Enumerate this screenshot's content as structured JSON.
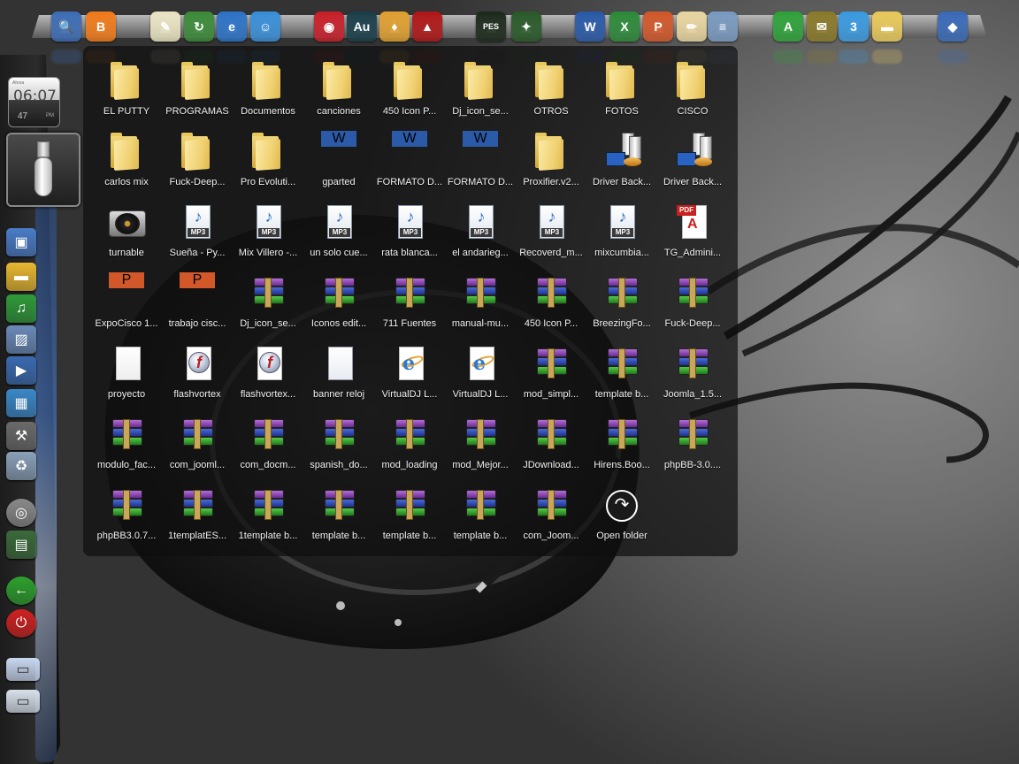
{
  "window": {
    "title": ""
  },
  "clock": {
    "time": "06:07",
    "date": "47",
    "ampm": "PM",
    "label": "Ahora"
  },
  "top_dock": {
    "icons": [
      {
        "name": "search-icon",
        "glyph": "🔍",
        "bg": "#3d6db5"
      },
      {
        "name": "blogger-icon",
        "glyph": "B",
        "bg": "#f07b1c"
      },
      {
        "name": "notepad-icon",
        "glyph": "✎",
        "bg": "#e9e4c2"
      },
      {
        "name": "sync-icon",
        "glyph": "↻",
        "bg": "#3c8b3a"
      },
      {
        "name": "internet-explorer-icon",
        "glyph": "e",
        "bg": "#2d73c8"
      },
      {
        "name": "messenger-icon",
        "glyph": "☺",
        "bg": "#3a8fd8"
      },
      {
        "name": "camera-icon",
        "glyph": "◉",
        "bg": "#c8202a"
      },
      {
        "name": "audition-icon",
        "glyph": "Au",
        "bg": "#1b3f4a"
      },
      {
        "name": "fl-studio-icon",
        "glyph": "♦",
        "bg": "#e0a030"
      },
      {
        "name": "game-icon",
        "glyph": "▲",
        "bg": "#b01818"
      },
      {
        "name": "pes-icon",
        "glyph": "PES",
        "bg": "#1c2a1c"
      },
      {
        "name": "nero-icon",
        "glyph": "✦",
        "bg": "#2a5a2a"
      },
      {
        "name": "word-icon",
        "glyph": "W",
        "bg": "#2a5aa8"
      },
      {
        "name": "excel-icon",
        "glyph": "X",
        "bg": "#2d8a3a"
      },
      {
        "name": "powerpoint-icon",
        "glyph": "P",
        "bg": "#d2582a"
      },
      {
        "name": "paint-icon",
        "glyph": "✏",
        "bg": "#e8d5a0"
      },
      {
        "name": "calculator-icon",
        "glyph": "≡",
        "bg": "#7a9ac0"
      },
      {
        "name": "acrobat-icon",
        "glyph": "A",
        "bg": "#2fa23a"
      },
      {
        "name": "mail-icon",
        "glyph": "✉",
        "bg": "#8a7a2a"
      },
      {
        "name": "windows-live-icon",
        "glyph": "3",
        "bg": "#3a9ae0"
      },
      {
        "name": "folder-icon",
        "glyph": "▬",
        "bg": "#e8c85a"
      },
      {
        "name": "network-icon",
        "glyph": "◆",
        "bg": "#3a6ab8"
      }
    ]
  },
  "left_bar": {
    "icons": [
      {
        "name": "computer-icon",
        "glyph": "▣",
        "bg": "#4a7cc8"
      },
      {
        "name": "documents-folder-icon",
        "glyph": "▬",
        "bg": "#e8b830"
      },
      {
        "name": "music-icon",
        "glyph": "♫",
        "bg": "#2f9a3a"
      },
      {
        "name": "pictures-icon",
        "glyph": "▨",
        "bg": "#6a8ab8"
      },
      {
        "name": "video-icon",
        "glyph": "▶",
        "bg": "#3a6ab0"
      },
      {
        "name": "control-panel-icon",
        "glyph": "▦",
        "bg": "#3a88c8"
      },
      {
        "name": "tools-icon",
        "glyph": "⚒",
        "bg": "#6a6a6a"
      },
      {
        "name": "recycle-bin-icon",
        "glyph": "♻",
        "bg": "#8aa0b8"
      },
      {
        "name": "speaker-icon",
        "glyph": "◎",
        "bg": "#8a8a8a"
      },
      {
        "name": "device-manager-icon",
        "glyph": "▤",
        "bg": "#3a6a3a"
      },
      {
        "name": "back-icon",
        "glyph": "←",
        "bg": "#2ca02c"
      },
      {
        "name": "power-icon",
        "glyph": "⏻",
        "bg": "#d02020"
      },
      {
        "name": "window-thumbnail-icon",
        "glyph": "▭",
        "bg": "#c8d8f0"
      },
      {
        "name": "window-thumbnail-icon-2",
        "glyph": "▭",
        "bg": "#d8e0ea"
      }
    ]
  },
  "stack": {
    "open_folder_label": "Open folder",
    "items": [
      {
        "label": "EL PUTTY",
        "type": "folder"
      },
      {
        "label": "PROGRAMAS",
        "type": "folder"
      },
      {
        "label": "Documentos",
        "type": "folder"
      },
      {
        "label": "canciones",
        "type": "folder"
      },
      {
        "label": "450 Icon P...",
        "type": "folder"
      },
      {
        "label": "Dj_icon_se...",
        "type": "folder"
      },
      {
        "label": "OTROS",
        "type": "folder"
      },
      {
        "label": "FOTOS",
        "type": "folder"
      },
      {
        "label": "CISCO",
        "type": "folder"
      },
      {
        "label": "carlos mix",
        "type": "folder"
      },
      {
        "label": "Fuck-Deep...",
        "type": "folder"
      },
      {
        "label": "Pro Evoluti...",
        "type": "folder"
      },
      {
        "label": "gparted",
        "type": "word"
      },
      {
        "label": "FORMATO D...",
        "type": "word"
      },
      {
        "label": "FORMATO D...",
        "type": "word"
      },
      {
        "label": "Proxifier.v2...",
        "type": "folder"
      },
      {
        "label": "Driver Back...",
        "type": "driver"
      },
      {
        "label": "Driver Back...",
        "type": "driver"
      },
      {
        "label": "turnable",
        "type": "turntable"
      },
      {
        "label": "Sueña - Py...",
        "type": "mp3"
      },
      {
        "label": "Mix Villero -...",
        "type": "mp3"
      },
      {
        "label": "un solo cue...",
        "type": "mp3"
      },
      {
        "label": "rata blanca...",
        "type": "mp3"
      },
      {
        "label": "el andarieg...",
        "type": "mp3"
      },
      {
        "label": "Recoverd_m...",
        "type": "mp3"
      },
      {
        "label": "mixcumbia...",
        "type": "mp3"
      },
      {
        "label": "TG_Admini...",
        "type": "pdf"
      },
      {
        "label": "ExpoCisco 1...",
        "type": "ppt"
      },
      {
        "label": "trabajo cisc...",
        "type": "ppt"
      },
      {
        "label": "Dj_icon_se...",
        "type": "rar"
      },
      {
        "label": "Iconos edit...",
        "type": "rar"
      },
      {
        "label": "711 Fuentes",
        "type": "rar"
      },
      {
        "label": "manual-mu...",
        "type": "rar"
      },
      {
        "label": "450 Icon P...",
        "type": "rar"
      },
      {
        "label": "BreezingFo...",
        "type": "rar"
      },
      {
        "label": "Fuck-Deep...",
        "type": "rar"
      },
      {
        "label": "proyecto",
        "type": "blank"
      },
      {
        "label": "flashvortex",
        "type": "flash"
      },
      {
        "label": "flashvortex...",
        "type": "flash"
      },
      {
        "label": "banner reloj",
        "type": "txt"
      },
      {
        "label": "VirtualDJ L...",
        "type": "ie"
      },
      {
        "label": "VirtualDJ L...",
        "type": "ie"
      },
      {
        "label": "mod_simpl...",
        "type": "rar"
      },
      {
        "label": "template b...",
        "type": "rar"
      },
      {
        "label": "Joomla_1.5...",
        "type": "rar"
      },
      {
        "label": "modulo_fac...",
        "type": "rar"
      },
      {
        "label": "com_jooml...",
        "type": "rar"
      },
      {
        "label": "com_docm...",
        "type": "rar"
      },
      {
        "label": "spanish_do...",
        "type": "rar"
      },
      {
        "label": "mod_loading",
        "type": "rar"
      },
      {
        "label": "mod_Mejor...",
        "type": "rar"
      },
      {
        "label": "JDownload...",
        "type": "rar"
      },
      {
        "label": "Hirens.Boo...",
        "type": "rar"
      },
      {
        "label": "phpBB-3.0....",
        "type": "rar"
      },
      {
        "label": "phpBB3.0.7...",
        "type": "rar"
      },
      {
        "label": "1templatES...",
        "type": "rar"
      },
      {
        "label": "1template b...",
        "type": "rar"
      },
      {
        "label": "template b...",
        "type": "rar"
      },
      {
        "label": "template b...",
        "type": "rar"
      },
      {
        "label": "template b...",
        "type": "rar"
      },
      {
        "label": "com_Joom...",
        "type": "rar"
      }
    ]
  },
  "colors": {
    "panel_bg": "rgba(14,14,14,0.70)",
    "label": "#f2f2f2",
    "folder": "#f1d274",
    "word": "#2a5aa8",
    "ppt": "#d2582a",
    "pdf": "#c8201e"
  }
}
